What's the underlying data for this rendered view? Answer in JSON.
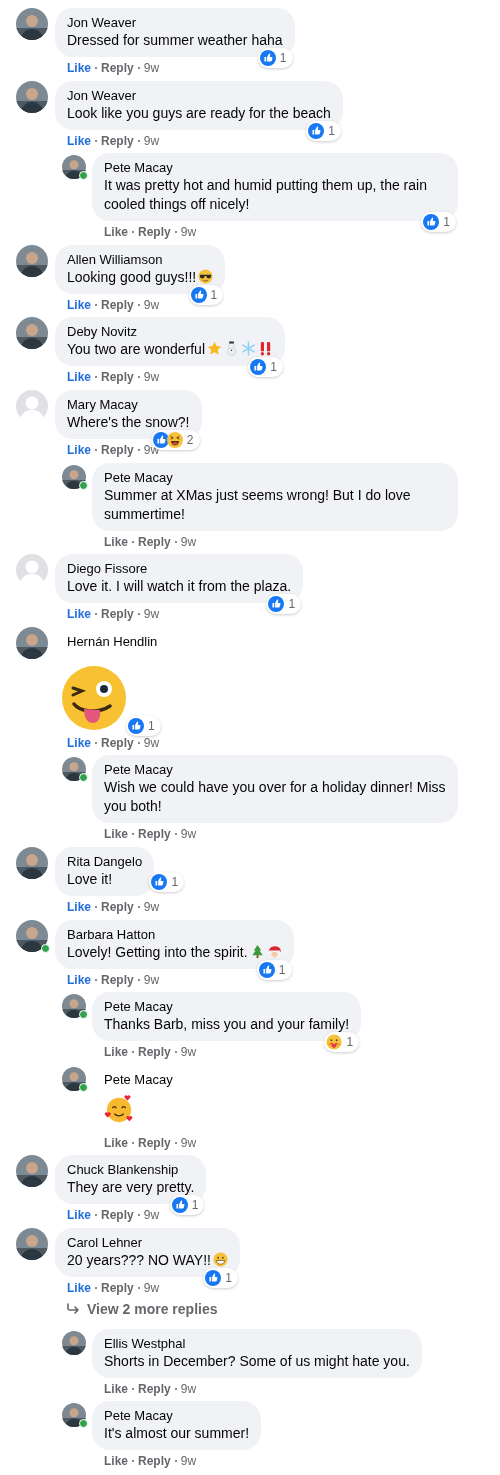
{
  "comments": [
    {
      "author": "Jon Weaver",
      "avatar": {
        "kind": "photo"
      },
      "online": false,
      "text": "Dressed for summer weather haha",
      "liked": true,
      "like": "Like",
      "reply": "Reply",
      "time": "9w",
      "reactions": {
        "items": [
          {
            "kind": "like"
          }
        ],
        "count": "1"
      }
    },
    {
      "author": "Jon Weaver",
      "avatar": {
        "kind": "photo"
      },
      "online": false,
      "text": "Look like you guys are ready for the beach",
      "liked": true,
      "like": "Like",
      "reply": "Reply",
      "time": "9w",
      "reactions": {
        "items": [
          {
            "kind": "like"
          }
        ],
        "count": "1"
      },
      "replies": [
        {
          "author": "Pete Macay",
          "avatar": {
            "kind": "photo"
          },
          "online": true,
          "text": "It was pretty hot and humid putting them up, the rain cooled things off nicely!",
          "liked": false,
          "like": "Like",
          "reply": "Reply",
          "time": "9w",
          "reactions": {
            "items": [
              {
                "kind": "like"
              }
            ],
            "count": "1"
          }
        }
      ]
    },
    {
      "author": "Allen Williamson",
      "avatar": {
        "kind": "photo"
      },
      "online": false,
      "text": "Looking good guys!!!",
      "emojis": [
        {
          "kind": "sunglasses"
        }
      ],
      "liked": true,
      "like": "Like",
      "reply": "Reply",
      "time": "9w",
      "reactions": {
        "items": [
          {
            "kind": "like"
          }
        ],
        "count": "1"
      }
    },
    {
      "author": "Deby Novitz",
      "avatar": {
        "kind": "photo"
      },
      "online": false,
      "text": "You two are wonderful",
      "emojis": [
        {
          "kind": "star"
        },
        {
          "kind": "snowman"
        },
        {
          "kind": "snowflake"
        },
        {
          "kind": "double_exclamation"
        }
      ],
      "liked": true,
      "like": "Like",
      "reply": "Reply",
      "time": "9w",
      "reactions": {
        "items": [
          {
            "kind": "like"
          }
        ],
        "count": "1"
      }
    },
    {
      "author": "Mary Macay",
      "avatar": {
        "kind": "default"
      },
      "online": false,
      "text": "Where's the snow?!",
      "liked": true,
      "like": "Like",
      "reply": "Reply",
      "time": "9w",
      "reactions": {
        "items": [
          {
            "kind": "like"
          },
          {
            "kind": "haha"
          }
        ],
        "count": "2"
      },
      "replies": [
        {
          "author": "Pete Macay",
          "avatar": {
            "kind": "photo"
          },
          "online": true,
          "text": "Summer at XMas just seems wrong! But I do love summertime!",
          "liked": false,
          "like": "Like",
          "reply": "Reply",
          "time": "9w"
        }
      ]
    },
    {
      "author": "Diego Fissore",
      "avatar": {
        "kind": "default"
      },
      "online": false,
      "text": "Love it. I will watch it from the plaza.",
      "liked": true,
      "like": "Like",
      "reply": "Reply",
      "time": "9w",
      "reactions": {
        "items": [
          {
            "kind": "like"
          }
        ],
        "count": "1"
      }
    },
    {
      "author": "Hernán Hendlin",
      "avatar": {
        "kind": "photo"
      },
      "online": false,
      "sticker": {
        "kind": "wink"
      },
      "liked": true,
      "like": "Like",
      "reply": "Reply",
      "time": "9w",
      "reactions": {
        "items": [
          {
            "kind": "like"
          }
        ],
        "count": "1"
      },
      "replies": [
        {
          "author": "Pete Macay",
          "avatar": {
            "kind": "photo"
          },
          "online": true,
          "text": "Wish we could have you over for a holiday dinner! Miss you both!",
          "liked": false,
          "like": "Like",
          "reply": "Reply",
          "time": "9w"
        }
      ]
    },
    {
      "author": "Rita Dangelo",
      "avatar": {
        "kind": "photo"
      },
      "online": false,
      "text": "Love it!",
      "liked": true,
      "like": "Like",
      "reply": "Reply",
      "time": "9w",
      "reactions": {
        "items": [
          {
            "kind": "like"
          }
        ],
        "count": "1"
      }
    },
    {
      "author": "Barbara Hatton",
      "avatar": {
        "kind": "photo"
      },
      "online": true,
      "text": "Lovely! Getting into the spirit.",
      "emojis": [
        {
          "kind": "tree"
        },
        {
          "kind": "santa"
        }
      ],
      "liked": true,
      "like": "Like",
      "reply": "Reply",
      "time": "9w",
      "reactions": {
        "items": [
          {
            "kind": "like"
          }
        ],
        "count": "1"
      },
      "replies": [
        {
          "author": "Pete Macay",
          "avatar": {
            "kind": "photo"
          },
          "online": true,
          "text": "Thanks Barb, miss you and your family!",
          "liked": false,
          "like": "Like",
          "reply": "Reply",
          "time": "9w",
          "reactions": {
            "items": [
              {
                "kind": "care"
              }
            ],
            "count": "1"
          }
        },
        {
          "author": "Pete Macay",
          "avatar": {
            "kind": "photo"
          },
          "online": true,
          "sticker": {
            "kind": "hearts"
          },
          "liked": false,
          "like": "Like",
          "reply": "Reply",
          "time": "9w"
        }
      ]
    },
    {
      "author": "Chuck Blankenship",
      "avatar": {
        "kind": "photo"
      },
      "online": false,
      "text": "They are very pretty.",
      "liked": true,
      "like": "Like",
      "reply": "Reply",
      "time": "9w",
      "reactions": {
        "items": [
          {
            "kind": "like"
          }
        ],
        "count": "1"
      }
    },
    {
      "author": "Carol Lehner",
      "avatar": {
        "kind": "photo"
      },
      "online": false,
      "text": "20 years??? NO WAY!!",
      "emojis": [
        {
          "kind": "grin"
        }
      ],
      "liked": true,
      "like": "Like",
      "reply": "Reply",
      "time": "9w",
      "reactions": {
        "items": [
          {
            "kind": "like"
          }
        ],
        "count": "1"
      },
      "more_replies": "View 2 more replies",
      "replies": [
        {
          "author": "Ellis Westphal",
          "avatar": {
            "kind": "photo"
          },
          "online": false,
          "text": "Shorts in December? Some of us might hate you.",
          "liked": false,
          "like": "Like",
          "reply": "Reply",
          "time": "9w"
        },
        {
          "author": "Pete Macay",
          "avatar": {
            "kind": "photo"
          },
          "online": true,
          "text": "It's almost our summer!",
          "liked": false,
          "like": "Like",
          "reply": "Reply",
          "time": "9w"
        }
      ]
    }
  ]
}
